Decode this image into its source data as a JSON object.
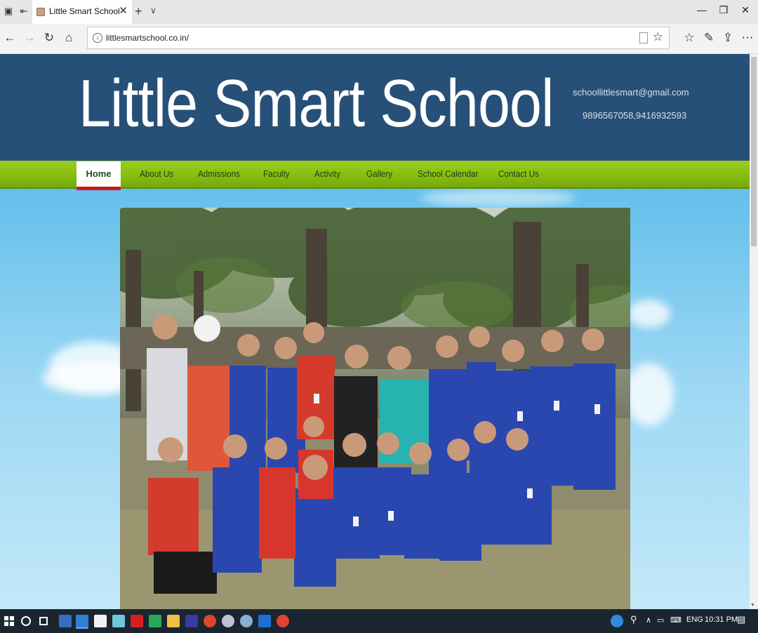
{
  "browser": {
    "tab_title": "Little Smart School",
    "url": "littlesmartschool.co.in/"
  },
  "site": {
    "title": "Little Smart School",
    "email": "schoollittlesmart@gmail.com",
    "phone": "9896567058,9416932593",
    "menu": [
      {
        "label": "Home"
      },
      {
        "label": "About Us"
      },
      {
        "label": "Admissions"
      },
      {
        "label": "Faculty"
      },
      {
        "label": "Activity"
      },
      {
        "label": "Gallery"
      },
      {
        "label": "School Calendar"
      },
      {
        "label": "Contact Us"
      }
    ],
    "active_menu": "Home"
  },
  "taskbar": {
    "language": "ENG",
    "time": "10:31 PM"
  },
  "colors": {
    "header": "#265077",
    "menu": "#88bd10",
    "active_indicator": "#d0181b",
    "sky": "#6cc3ec"
  }
}
